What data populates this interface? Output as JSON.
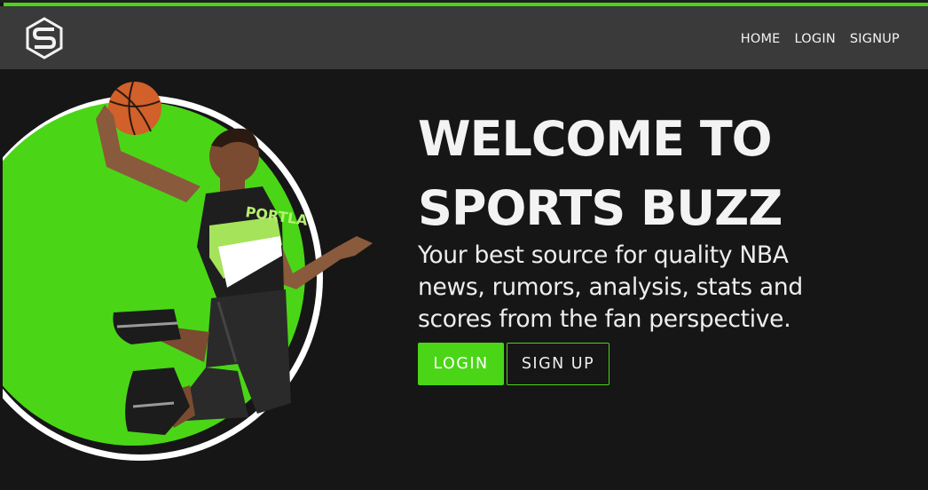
{
  "header": {
    "nav": [
      "HOME",
      "LOGIN",
      "SIGNUP"
    ]
  },
  "hero": {
    "title_line1": "WELCOME TO",
    "title_line2": "SPORTS BUZZ",
    "subtitle": "Your best source for quality NBA news, rumors, analysis, stats and scores from the fan perspective.",
    "login_label": "LOGIN",
    "signup_label": "SIGN UP",
    "jersey_text": "PORTLA"
  },
  "colors": {
    "accent": "#4ad616",
    "header_bg": "#3a3a3a",
    "page_bg": "#161616"
  }
}
